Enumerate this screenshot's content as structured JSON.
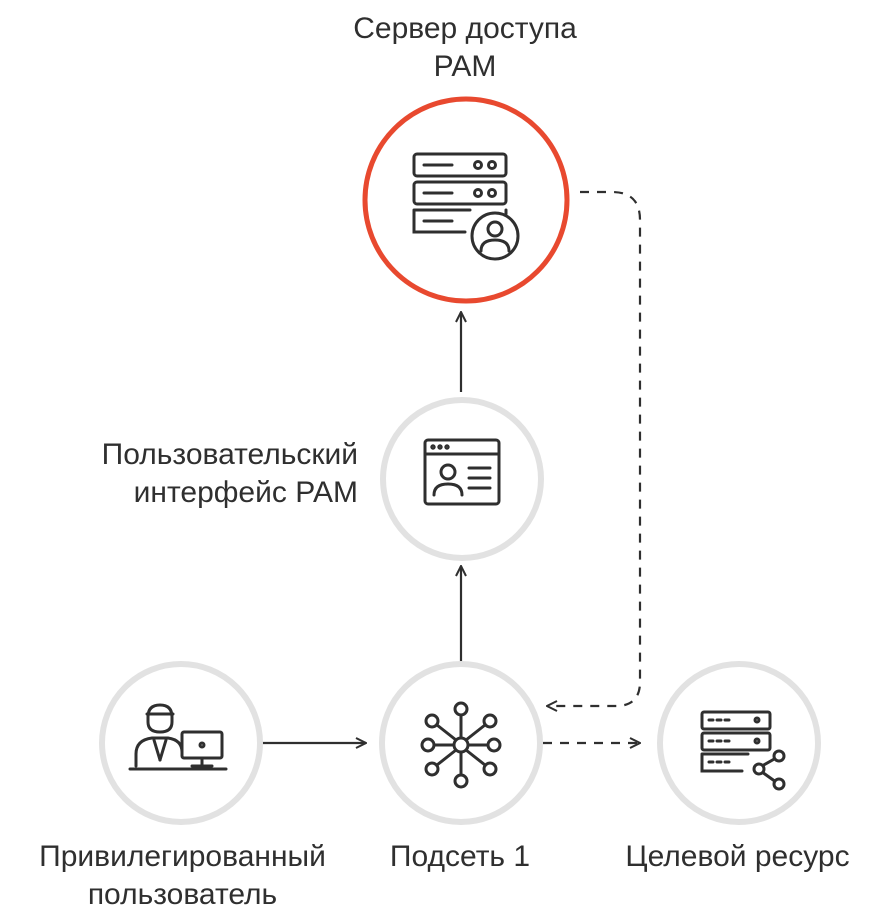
{
  "nodes": {
    "pam_server": {
      "label_line1": "Сервер доступа",
      "label_line2": "PAM",
      "icon": "server-user-icon",
      "ring_color": "#e8492f"
    },
    "pam_ui": {
      "label_line1": "Пользовательский",
      "label_line2": "интерфейс PAM",
      "icon": "profile-window-icon",
      "ring_color": "#e2e2e2"
    },
    "privileged_user": {
      "label_line1": "Привилегированный",
      "label_line2": "пользователь",
      "icon": "user-at-computer-icon",
      "ring_color": "#e2e2e2"
    },
    "subnet": {
      "label": "Подсеть 1",
      "icon": "network-hub-icon",
      "ring_color": "#e2e2e2"
    },
    "target": {
      "label": "Целевой ресурс",
      "icon": "server-share-icon",
      "ring_color": "#e2e2e2"
    }
  },
  "colors": {
    "accent": "#e8492f",
    "ring": "#e2e2e2",
    "line": "#2f2f2f"
  }
}
